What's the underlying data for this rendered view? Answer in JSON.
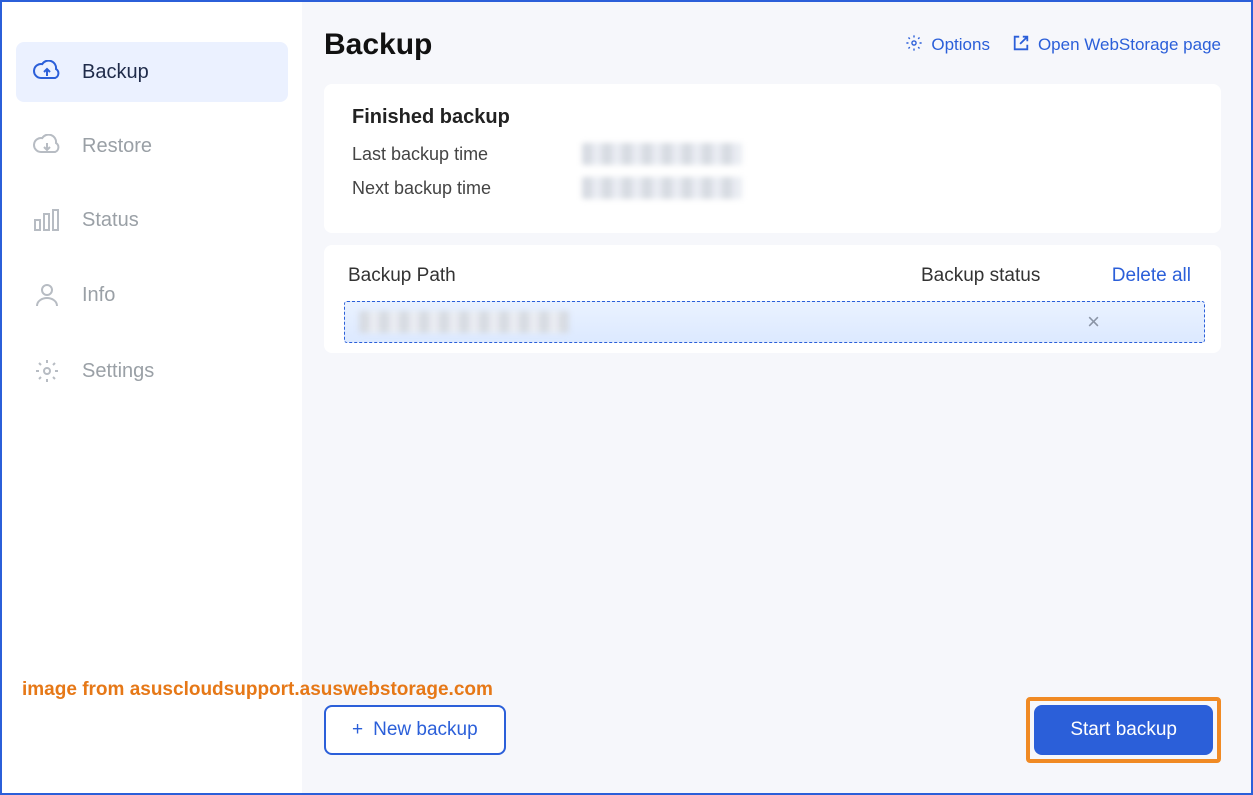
{
  "sidebar": {
    "items": [
      {
        "label": "Backup",
        "icon": "cloud-up-icon",
        "active": true
      },
      {
        "label": "Restore",
        "icon": "cloud-down-icon",
        "active": false
      },
      {
        "label": "Status",
        "icon": "bars-icon",
        "active": false
      },
      {
        "label": "Info",
        "icon": "user-icon",
        "active": false
      },
      {
        "label": "Settings",
        "icon": "gear-icon",
        "active": false
      }
    ]
  },
  "header": {
    "title": "Backup",
    "options_label": "Options",
    "open_page_label": "Open WebStorage page"
  },
  "finished_card": {
    "title": "Finished backup",
    "last_label": "Last backup time",
    "next_label": "Next backup time"
  },
  "table": {
    "col_path": "Backup Path",
    "col_status": "Backup status",
    "delete_all": "Delete all"
  },
  "footer": {
    "new_backup": "New backup",
    "start_backup": "Start backup"
  },
  "watermark": "image from asuscloudsupport.asuswebstorage.com"
}
